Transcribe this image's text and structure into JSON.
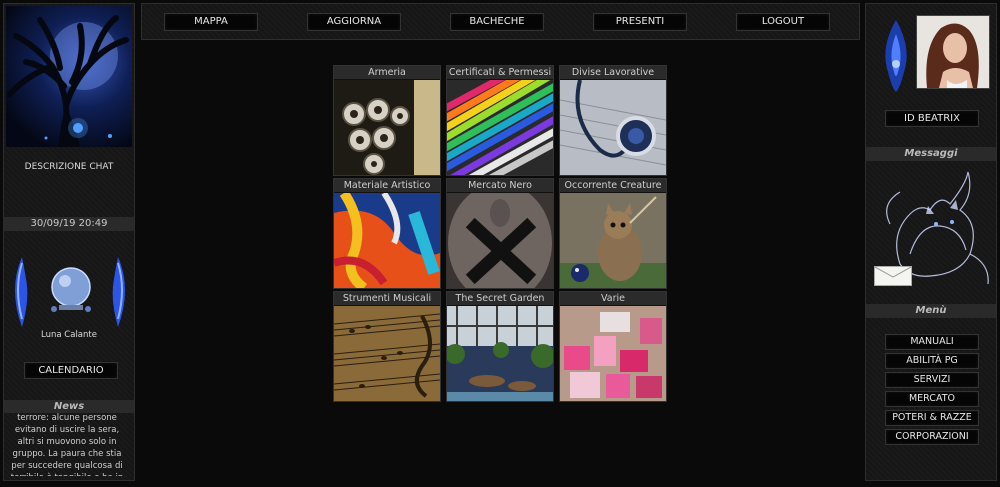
{
  "topnav": [
    "MAPPA",
    "AGGIORNA",
    "BACHECHE",
    "PRESENTI",
    "LOGOUT"
  ],
  "left": {
    "description_label": "DESCRIZIONE CHAT",
    "datetime": "30/09/19 20:49",
    "moon_label": "Luna Calante",
    "calendar_button": "CALENDARIO",
    "news_title": "News",
    "news_text": "terrore: alcune persone evitano di uscire la sera, altri si muovono solo in gruppo. La paura che stia per succedere qualcosa di terribile è tangibile e ha in parte attutito"
  },
  "right": {
    "id_button": "ID BEATRIX",
    "messages_title": "Messaggi",
    "menu_title": "Menù",
    "menu_items": [
      "MANUALI",
      "ABILITÀ PG",
      "SERVIZI",
      "MERCATO",
      "POTERI & RAZZE",
      "CORPORAZIONI"
    ]
  },
  "categories": [
    "Armeria",
    "Certificati & Permessi",
    "Divise Lavorative",
    "Materiale Artistico",
    "Mercato Nero",
    "Occorrente Creature",
    "Strumenti Musicali",
    "The Secret Garden",
    "Varie"
  ],
  "colors": {
    "accent_blue": "#3a6bff",
    "panel_bg": "#161616",
    "button_bg": "#050505"
  }
}
